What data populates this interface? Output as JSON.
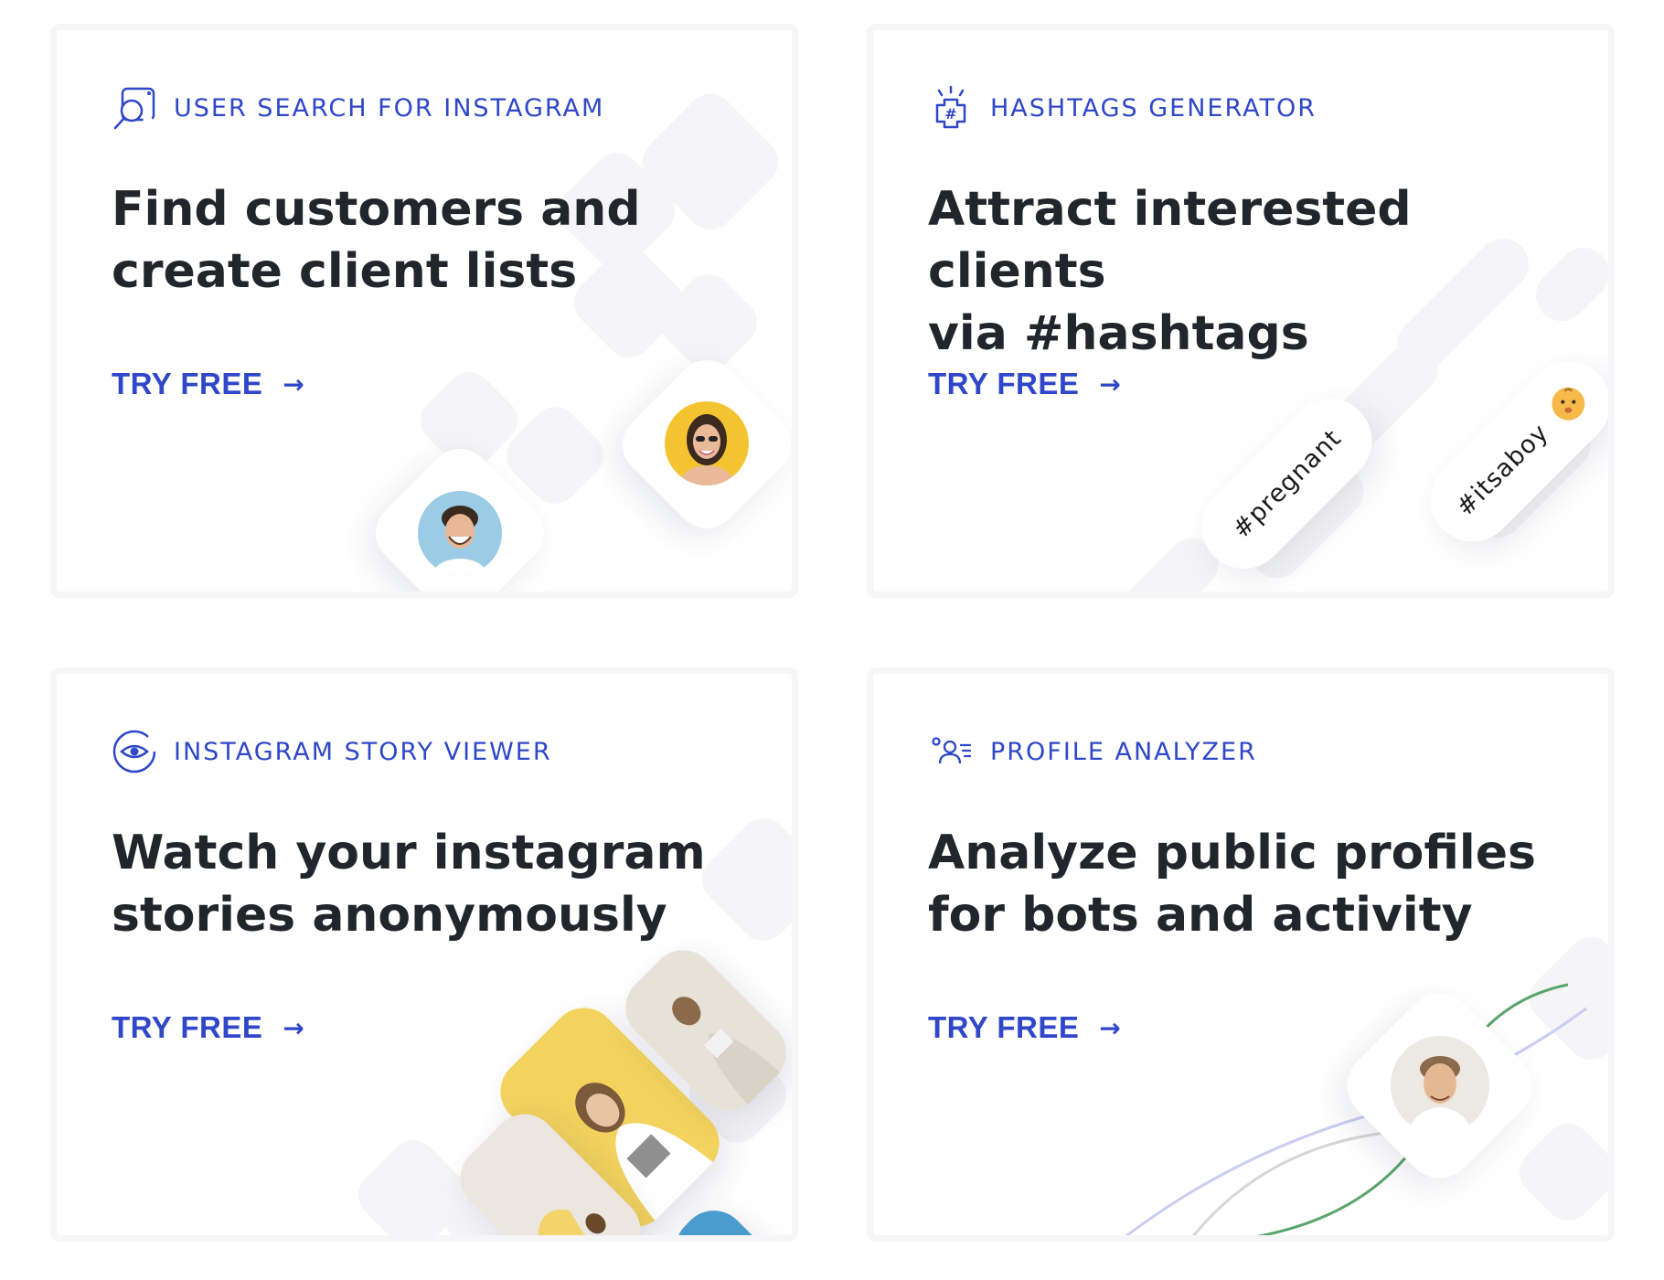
{
  "colors": {
    "accent": "#2f47c8",
    "title": "#22252b",
    "card_border": "#f6f6f8",
    "deco": "#f5f5f7",
    "graph_green": "#5aa56b",
    "graph_lavender": "#c9cdf2",
    "graph_gray": "#d6d6d6"
  },
  "cards": [
    {
      "label": "USER SEARCH FOR INSTAGRAM",
      "icon": "user-search-icon",
      "title_line1": "Find customers and",
      "title_line2": "create client lists",
      "cta": "TRY FREE",
      "cta_arrow": "→"
    },
    {
      "label": "HASHTAGS GENERATOR",
      "icon": "hashtag-gear-icon",
      "title_line1": "Attract interested clients",
      "title_line2": "via #hashtags",
      "cta": "TRY FREE",
      "cta_arrow": "→",
      "hashtags": [
        "#pregnant",
        "#itsaboy"
      ]
    },
    {
      "label": "INSTAGRAM STORY VIEWER",
      "icon": "eye-icon",
      "title_line1": "Watch your instagram",
      "title_line2": "stories anonymously",
      "cta": "TRY FREE",
      "cta_arrow": "→"
    },
    {
      "label": "PROFILE ANALYZER",
      "icon": "profile-analyzer-icon",
      "title_line1": "Analyze public profiles",
      "title_line2": "for bots and activity",
      "cta": "TRY FREE",
      "cta_arrow": "→"
    }
  ]
}
